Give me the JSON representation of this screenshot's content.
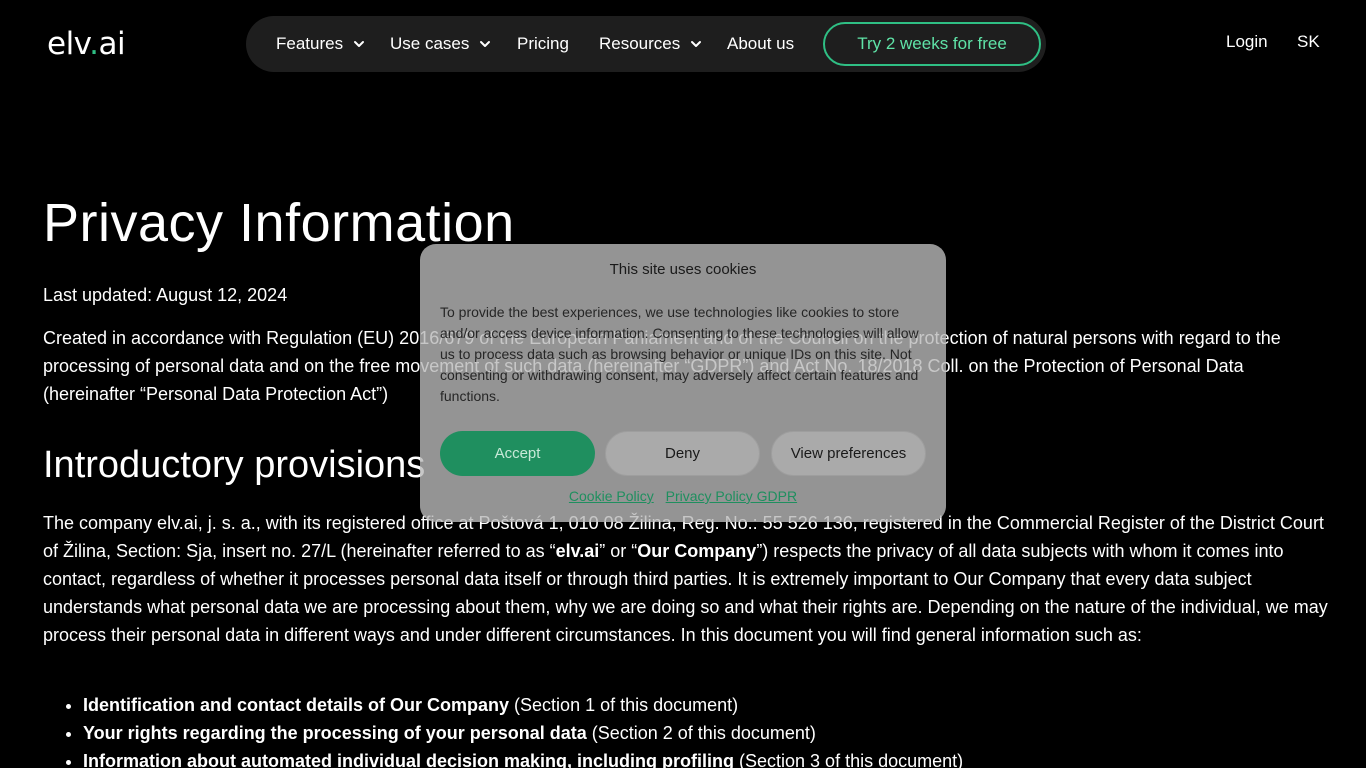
{
  "header": {
    "logo_prefix": "elv",
    "logo_dot": ".",
    "logo_suffix": "ai",
    "nav": [
      {
        "label": "Features",
        "has_dropdown": true
      },
      {
        "label": "Use cases",
        "has_dropdown": true
      },
      {
        "label": "Pricing",
        "has_dropdown": false
      },
      {
        "label": "Resources",
        "has_dropdown": true
      },
      {
        "label": "About us",
        "has_dropdown": false
      }
    ],
    "cta_label": "Try 2 weeks for free",
    "login_label": "Login",
    "language_label": "SK"
  },
  "main": {
    "title": "Privacy Information",
    "last_updated": "Last updated: August 12, 2024",
    "intro": "Created in accordance with Regulation (EU) 2016/679 of the European Parliament and of the Council on the protection of natural persons with regard to the processing of personal data and on the free movement of such data (hereinafter “GDPR”) and Act No. 18/2018 Coll. on the Protection of Personal Data (hereinafter “Personal Data Protection Act”)",
    "section_title": "Introductory provisions",
    "company_text_1": "The company elv.ai, j. s. a., with its registered office at Poštová 1, 010 08 Žilina, Reg. No.: 55 526 136, registered in the Commercial Register of the District Court of Žilina, Section: Sja, insert no. 27/L (hereinafter referred to as “",
    "company_bold_1": "elv.ai",
    "company_text_2": "” or “",
    "company_bold_2": "Our Company",
    "company_text_3": "”) respects the privacy of all data subjects with whom it comes into contact, regardless of whether it processes personal data itself or through third parties. It is extremely important to Our Company that every data subject understands what personal data we are processing about them, why we are doing so and what their rights are. Depending on the nature of the individual, we may process their personal data in different ways and under different circumstances. In this document you will find general information such as:",
    "bullets": [
      {
        "bold": "Identification and contact details of Our Company",
        "rest": " (Section 1 of this document)"
      },
      {
        "bold": "Your rights regarding the processing of your personal data",
        "rest": " (Section 2 of this document)"
      },
      {
        "bold": "Information about automated individual decision making, including profiling",
        "rest": " (Section 3 of this document)"
      }
    ]
  },
  "cookie": {
    "title": "This site uses cookies",
    "text": "To provide the best experiences, we use technologies like cookies to store and/or access device information. Consenting to these technologies will allow us to process data such as browsing behavior or unique IDs on this site. Not consenting or withdrawing consent, may adversely affect certain features and functions.",
    "accept_label": "Accept",
    "deny_label": "Deny",
    "preferences_label": "View preferences",
    "cookie_policy_link": "Cookie Policy",
    "privacy_policy_link": "Privacy Policy GDPR"
  },
  "colors": {
    "accent": "#2fbf84",
    "background": "#000000",
    "nav_bg": "#1e1e1e"
  }
}
